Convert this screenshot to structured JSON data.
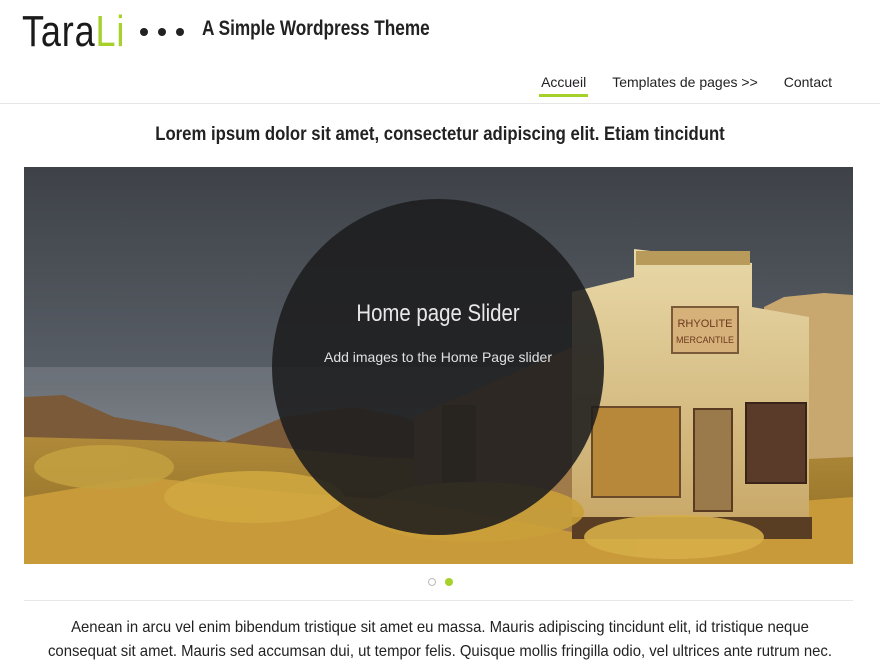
{
  "site": {
    "logo_main": "Tara",
    "logo_accent": "Li",
    "tagline": "A Simple Wordpress Theme",
    "accent_color": "#a6d12a"
  },
  "nav": {
    "items": [
      {
        "label": "Accueil",
        "active": true
      },
      {
        "label": "Templates de pages >>",
        "active": false
      },
      {
        "label": "Contact",
        "active": false
      }
    ]
  },
  "headline": "Lorem ipsum dolor sit amet, consectetur adipiscing elit. Etiam tincidunt",
  "slider": {
    "title": "Home page Slider",
    "subtitle": "Add images to the Home Page slider",
    "sign_text": "RHYOLITE MERCANTILE",
    "pager": [
      {
        "active": false
      },
      {
        "active": true
      }
    ]
  },
  "body": {
    "line1": "Aenean in arcu vel enim bibendum tristique sit amet eu massa. Mauris adipiscing tincidunt elit, id tristique neque",
    "line2": "consequat sit amet. Mauris sed accumsan dui, ut tempor felis. Quisque mollis fringilla odio, vel ultrices ante rutrum nec."
  }
}
